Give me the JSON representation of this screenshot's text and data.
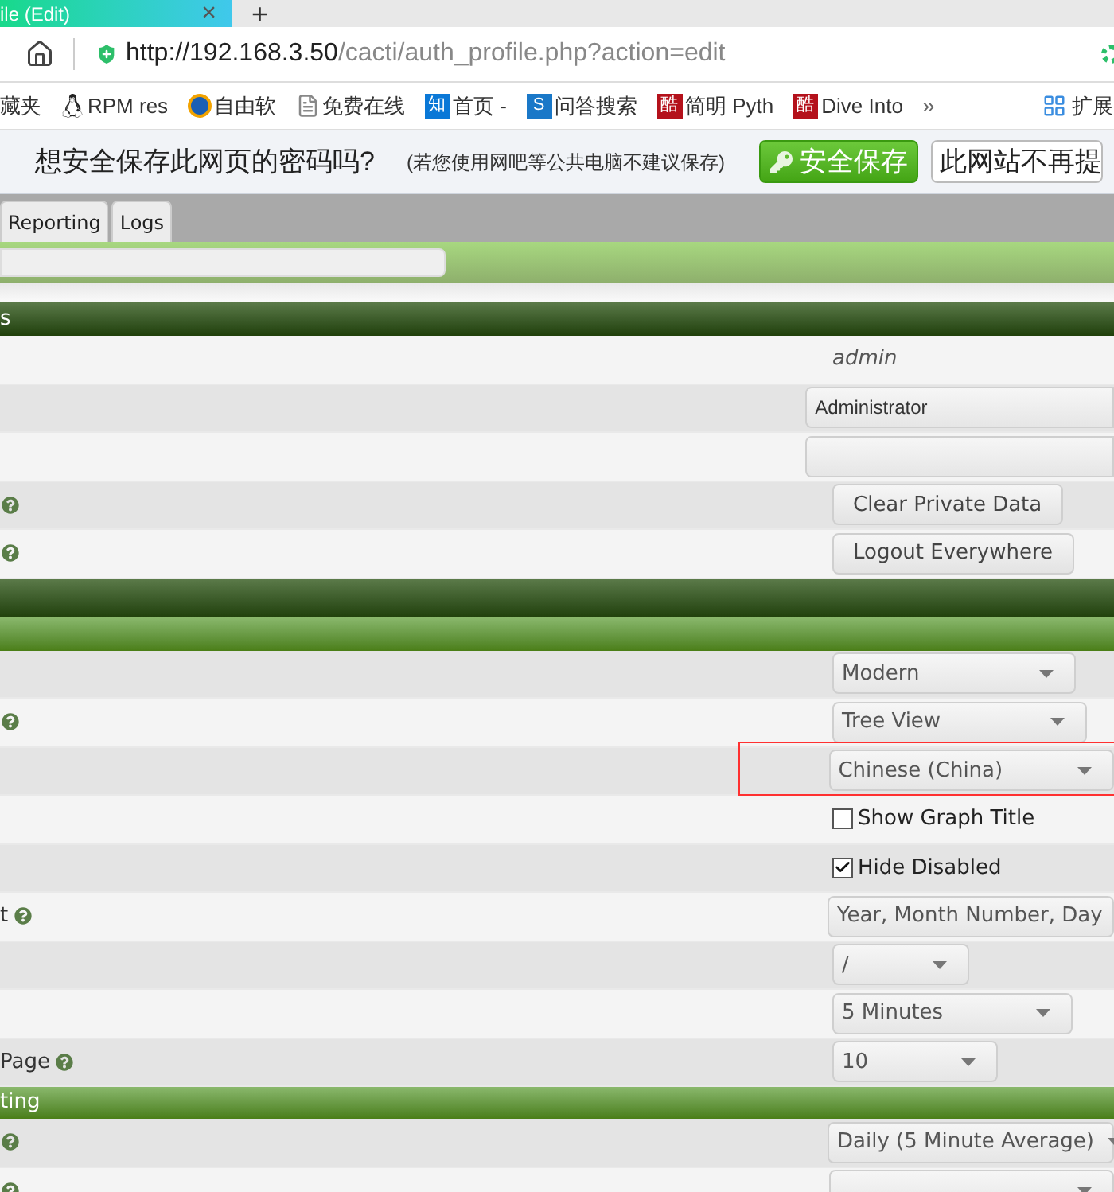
{
  "browser_tab": {
    "title": "ile (Edit)",
    "close": "×",
    "new_tab": "+"
  },
  "address_bar": {
    "host": "http://192.168.3.50",
    "path": "/cacti/auth_profile.php?action=edit"
  },
  "bookmarks": [
    {
      "kind": "plain",
      "label": "藏夹"
    },
    {
      "kind": "penguin",
      "label": "RPM res"
    },
    {
      "kind": "circle",
      "label": "自由软"
    },
    {
      "kind": "doc",
      "label": "免费在线"
    },
    {
      "kind": "badge",
      "badge": "知",
      "color": "#0a78d7",
      "label": "首页 -"
    },
    {
      "kind": "badge",
      "badge": "S",
      "color": "#1a78c8",
      "label": "问答搜索"
    },
    {
      "kind": "badge",
      "badge": "酷",
      "color": "#b4111b",
      "label": "简明 Pyth"
    },
    {
      "kind": "badge",
      "badge": "酷",
      "color": "#b4111b",
      "label": "Dive Into"
    }
  ],
  "bookmarks_more": "»",
  "extensions": "扩展",
  "password_prompt": {
    "question": "想安全保存此网页的密码吗?",
    "hint": "(若您使用网吧等公共电脑不建议保存)",
    "save": "安全保存",
    "never": "此网站不再提"
  },
  "app_tabs": [
    {
      "label": "Reporting",
      "selected": false
    },
    {
      "label": "Logs",
      "selected": false
    }
  ],
  "rows": [
    {
      "kind": "dark_header",
      "title": "s"
    },
    {
      "kind": "field",
      "help": false,
      "control": {
        "kind": "text",
        "value": "admin"
      }
    },
    {
      "kind": "field",
      "help": false,
      "control": {
        "kind": "input",
        "value": "Administrator"
      }
    },
    {
      "kind": "field",
      "help": false,
      "control": {
        "kind": "input"
      }
    },
    {
      "kind": "field",
      "help": true,
      "control": {
        "kind": "button",
        "value": "Clear Private Data"
      }
    },
    {
      "kind": "field",
      "help": true,
      "control": {
        "kind": "button",
        "value": "Logout Everywhere"
      }
    },
    {
      "kind": "dark_header"
    },
    {
      "kind": "green_header"
    },
    {
      "kind": "field",
      "help": false,
      "control": {
        "kind": "select",
        "value": "Modern"
      }
    },
    {
      "kind": "field",
      "help": true,
      "control": {
        "kind": "select",
        "value": "Tree View"
      }
    },
    {
      "kind": "field",
      "help": false,
      "control": {
        "kind": "select",
        "value": "Chinese (China)"
      }
    },
    {
      "kind": "field",
      "help": false,
      "control": {
        "kind": "checkbox",
        "value": "Show Graph Title",
        "checked": false
      }
    },
    {
      "kind": "field",
      "help": false,
      "control": {
        "kind": "checkbox",
        "value": "Hide Disabled",
        "checked": true
      }
    },
    {
      "kind": "field",
      "label": "t",
      "help": true,
      "control": {
        "kind": "select",
        "value": "Year, Month Number, Day"
      }
    },
    {
      "kind": "field",
      "help": false,
      "control": {
        "kind": "select",
        "value": "/"
      }
    },
    {
      "kind": "field",
      "help": false,
      "control": {
        "kind": "select",
        "value": "5 Minutes"
      }
    },
    {
      "kind": "field",
      "label": "Page",
      "help": true,
      "control": {
        "kind": "select",
        "value": "10"
      }
    },
    {
      "kind": "green_header",
      "title": "ting"
    },
    {
      "kind": "field",
      "help": true,
      "control": {
        "kind": "select",
        "value": "Daily (5 Minute Average)"
      }
    },
    {
      "kind": "field",
      "help": true,
      "control": {
        "kind": "select"
      }
    }
  ]
}
